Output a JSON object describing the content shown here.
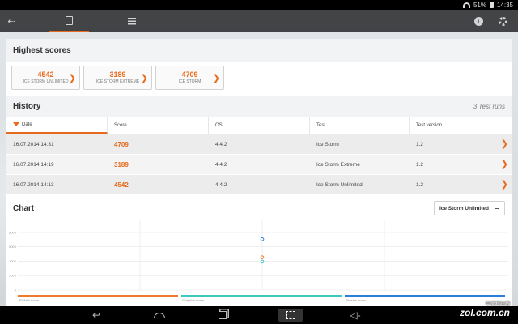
{
  "status_bar": {
    "battery": "51%",
    "time": "14:35"
  },
  "highest_scores": {
    "title": "Highest scores",
    "items": [
      {
        "score": "4542",
        "label": "ICE STORM UNLIMITED"
      },
      {
        "score": "3189",
        "label": "ICE STORM EXTREME"
      },
      {
        "score": "4709",
        "label": "ICE STORM"
      }
    ]
  },
  "history": {
    "title": "History",
    "runs_label": "3 Test runs",
    "columns": [
      "Date",
      "Score",
      "OS",
      "Test",
      "Test version"
    ],
    "rows": [
      {
        "date": "16.07.2014 14:31",
        "score": "4709",
        "os": "4.4.2",
        "test": "Ice Storm",
        "version": "1.2"
      },
      {
        "date": "16.07.2014 14:19",
        "score": "3189",
        "os": "4.4.2",
        "test": "Ice Storm Extreme",
        "version": "1.2"
      },
      {
        "date": "16.07.2014 14:13",
        "score": "4542",
        "os": "4.4.2",
        "test": "Ice Storm Unlimited",
        "version": "1.2"
      }
    ]
  },
  "chart_section": {
    "title": "Chart",
    "dropdown_value": "Ice Storm Unlimited"
  },
  "chart_data": {
    "type": "scatter",
    "y_ticks": [
      "8000",
      "6000",
      "4000",
      "2000",
      "0"
    ],
    "ylim": [
      0,
      9000
    ],
    "legend": [
      "3DMark score",
      "Graphics score",
      "Physics score"
    ],
    "series": [
      {
        "name": "3DMark score",
        "color": "#f07a2a",
        "points": [
          4542
        ]
      },
      {
        "name": "Graphics score",
        "color": "#3cc8c0",
        "points": [
          3950
        ]
      },
      {
        "name": "Physics score",
        "color": "#2d7fd6",
        "points": [
          7050
        ]
      }
    ]
  },
  "watermark": {
    "text": "zol.com.cn",
    "small": "中关村在线"
  },
  "colors": {
    "accent": "#e86a1c"
  }
}
